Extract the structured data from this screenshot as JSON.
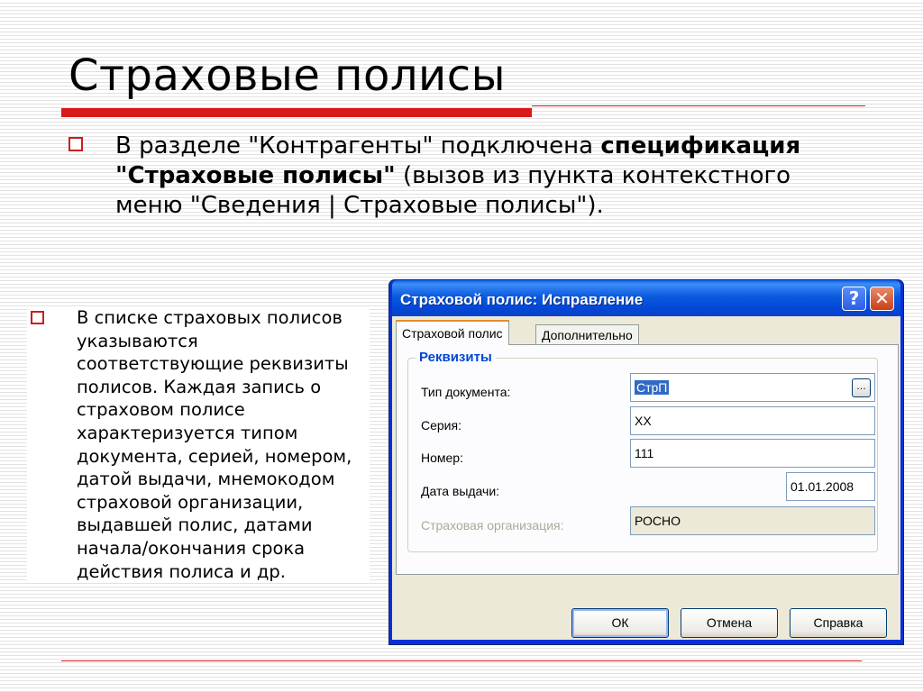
{
  "slide": {
    "title": "Страховые полисы",
    "bullet1": {
      "text_before": "В разделе \"Контрагенты\" подключена ",
      "bold_text": "спецификация \"Страховые полисы\"",
      "text_after": " (вызов из пункта контекстного меню \"Сведения | Страховые полисы\")."
    },
    "bullet2": {
      "text": "В списке страховых полисов указываются соответствующие реквизиты полисов. Каждая запись о страховом полисе характеризуется типом документа, серией, номером, датой выдачи, мнемокодом страховой организации, выдавшей полис, датами начала/окончания срока действия полиса и др."
    }
  },
  "dialog": {
    "title": "Страховой полис: Исправление",
    "help_glyph": "?",
    "close_glyph": "✕",
    "tabs": [
      {
        "label": "Страховой полис",
        "active": true
      },
      {
        "label": "Дополнительно",
        "active": false
      }
    ],
    "group_title": "Реквизиты",
    "fields": {
      "doc_type": {
        "label": "Тип документа:",
        "value": "СтрП"
      },
      "series": {
        "label": "Серия:",
        "value": "ХХ"
      },
      "number": {
        "label": "Номер:",
        "value": "111"
      },
      "issue_date": {
        "label": "Дата выдачи:",
        "value": "01.01.2008"
      },
      "insurer": {
        "label": "Страховая организация:",
        "value": "РОСНО",
        "disabled": true
      }
    },
    "dots_glyph": "…",
    "buttons": {
      "ok": "ОК",
      "cancel": "Отмена",
      "help": "Справка"
    }
  },
  "colors": {
    "accent_red": "#d81a1a",
    "xp_blue": "#0831d9",
    "group_title_blue": "#0046d5"
  }
}
